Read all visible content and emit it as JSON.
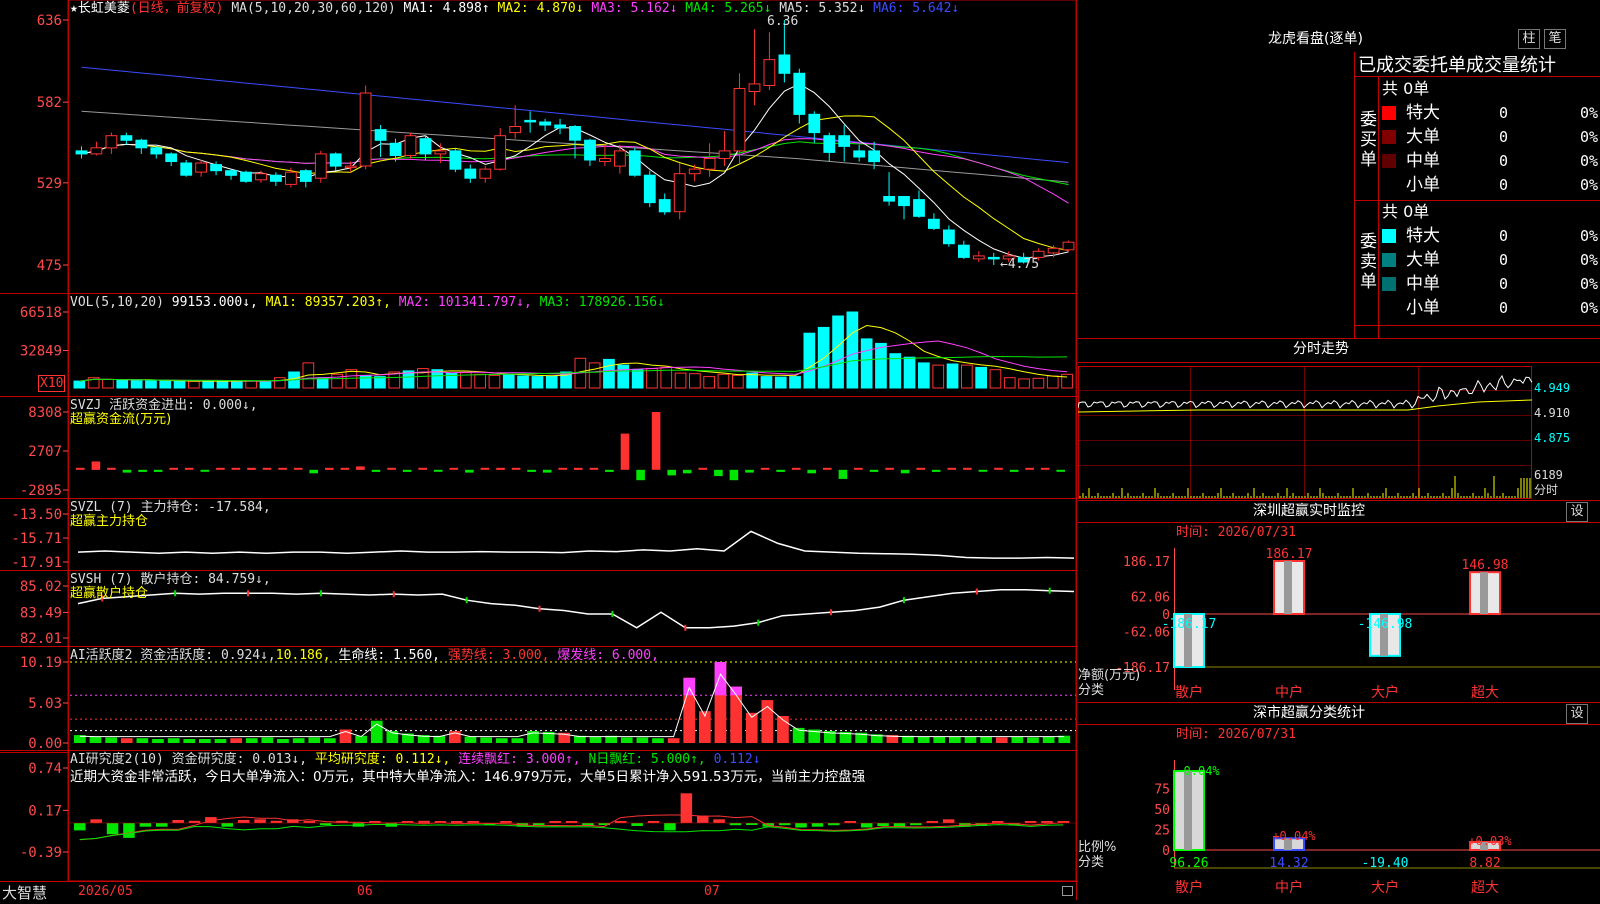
{
  "colors": {
    "up": "#ff3232",
    "down": "#00ffff",
    "grid": "#c00000",
    "axis": "#ff4a4a",
    "white": "#ffffff",
    "yellow": "#ffff00",
    "magenta": "#ff40ff",
    "green": "#00e600",
    "blue": "#3a4cff",
    "gray": "#9a9a9a",
    "olive": "#8c8c00",
    "darkred": "#800000",
    "teal": "#008080"
  },
  "header": {
    "star": "★",
    "name": "长虹美菱",
    "period": "(日线，前复权)",
    "ma_label": "MA(5,10,20,30,60,120)",
    "ma1": "MA1: 4.898↑",
    "ma2": "MA2: 4.870↓",
    "ma3": "MA3: 5.162↓",
    "ma4": "MA4: 5.265↓",
    "ma5": "MA5: 5.352↓",
    "ma6": "MA6: 5.642↓"
  },
  "price_axis": [
    "636",
    "582",
    "529",
    "475"
  ],
  "price_annot": {
    "high": "6.36",
    "low": "←4.75"
  },
  "vol": {
    "title": "VOL(5,10,20)",
    "value": "99153.000↓,",
    "ma1": "MA1: 89357.203↑,",
    "ma2": "MA2: 101341.797↓,",
    "ma3": "MA3: 178926.156↓",
    "axis": [
      "66518",
      "32849"
    ],
    "unit": "X10"
  },
  "svzj": {
    "title": "SVZJ  活跃资金进出: 0.000↓,",
    "subtitle": "超赢资金流(万元)",
    "axis": [
      "8308",
      "2707",
      "-2895"
    ]
  },
  "svzl": {
    "title": "SVZL (7) 主力持仓: -17.584,",
    "subtitle": "超赢主力持仓",
    "axis": [
      "-13.50",
      "-15.71",
      "-17.91"
    ]
  },
  "svsh": {
    "title": "SVSH (7) 散户持仓: 84.759↓,",
    "subtitle": "超赢散户持仓",
    "axis": [
      "85.02",
      "83.49",
      "82.01"
    ]
  },
  "ai1": {
    "t1": "AI活跃度2 资金活跃度: 0.924↓,",
    "t2": "10.186,",
    "t3": "生命线: 1.560,",
    "t4": "强势线: 3.000,",
    "t5": "爆发线: 6.000,",
    "axis": [
      "10.19",
      "5.03",
      "0.00"
    ]
  },
  "ai2": {
    "t1": "AI研究度2(10) 资金研究度: 0.013↓,",
    "t2": "平均研究度: 0.112↓,",
    "t3": "连续飘红: 3.000↑,",
    "t4": "N日飘红: 5.000↑,",
    "t5": "0.112↓",
    "note": "近期大资金非常活跃，今日大单净流入：0万元，其中特大单净流入：146.979万元，大单5日累计净入591.53万元，当前主力控盘强",
    "axis": [
      "0.74",
      "0.17",
      "-0.39"
    ]
  },
  "bottom": {
    "brand": "大智慧",
    "dates": [
      "2026/05",
      "06",
      "07"
    ]
  },
  "longhu": {
    "title": "龙虎看盘(逐单)",
    "btn1": "柱",
    "btn2": "笔",
    "stat_title": "已成交委托单成交量统计",
    "buy_label": "委买单",
    "sell_label": "委卖单",
    "buy_total": "共 0单",
    "sell_total": "共 0单",
    "buy_rows": [
      {
        "label": "特大",
        "count": "0",
        "pct": "0%",
        "color": "#ff0000"
      },
      {
        "label": "大单",
        "count": "0",
        "pct": "0%",
        "color": "#800000"
      },
      {
        "label": "中单",
        "count": "0",
        "pct": "0%",
        "color": "#600000"
      },
      {
        "label": "小单",
        "count": "0",
        "pct": "0%",
        "color": "#000000"
      }
    ],
    "sell_rows": [
      {
        "label": "特大",
        "count": "0",
        "pct": "0%",
        "color": "#00ffff"
      },
      {
        "label": "大单",
        "count": "0",
        "pct": "0%",
        "color": "#008080"
      },
      {
        "label": "中单",
        "count": "0",
        "pct": "0%",
        "color": "#007070"
      },
      {
        "label": "小单",
        "count": "0",
        "pct": "0%",
        "color": "#000000"
      }
    ]
  },
  "intraday": {
    "title": "分时走势",
    "axis": [
      "4.949",
      "4.910",
      "4.875"
    ],
    "vol_top": "6189",
    "vol_label": "分时"
  },
  "monitor": {
    "title": "深圳超赢实时监控",
    "btn": "设",
    "time": "时间: 2026/07/31",
    "axis": [
      "186.17",
      "62.06",
      "0",
      "-62.06",
      "-186.17"
    ],
    "ylabel1": "净额(万元)",
    "ylabel2": "分类",
    "labels": [
      "散户",
      "中户",
      "大户",
      "超大"
    ],
    "bar_labels": [
      "-186.17",
      "186.17",
      "-146.98",
      "146.98"
    ]
  },
  "classify": {
    "title": "深市超赢分类统计",
    "btn": "设",
    "time": "时间: 2026/07/31",
    "axis": [
      "75",
      "50",
      "25",
      "0"
    ],
    "ylabel1": "比例%",
    "ylabel2": "分类",
    "labels": [
      "散户",
      "中户",
      "大户",
      "超大"
    ],
    "top_labels": [
      "-0.04%",
      "+0.04%",
      "+0.03%"
    ],
    "values": [
      "96.26",
      "14.32",
      "-19.40",
      "8.82"
    ]
  },
  "chart_data": [
    {
      "type": "candlestick",
      "title": "长虹美菱 (日线，前复权)",
      "ylim": [
        4.75,
        6.36
      ],
      "ma_labels": [
        "MA1",
        "MA2",
        "MA3",
        "MA4",
        "MA5",
        "MA6"
      ],
      "x": [
        "2026/05",
        "06",
        "07"
      ],
      "candles": [
        [
          5.5,
          5.48,
          5.53,
          5.45
        ],
        [
          5.48,
          5.52,
          5.56,
          5.47
        ],
        [
          5.52,
          5.6,
          5.62,
          5.48
        ],
        [
          5.6,
          5.57,
          5.62,
          5.54
        ],
        [
          5.57,
          5.52,
          5.58,
          5.48
        ],
        [
          5.52,
          5.48,
          5.53,
          5.45
        ],
        [
          5.48,
          5.43,
          5.49,
          5.4
        ],
        [
          5.42,
          5.34,
          5.44,
          5.33
        ],
        [
          5.36,
          5.42,
          5.44,
          5.33
        ],
        [
          5.41,
          5.37,
          5.43,
          5.34
        ],
        [
          5.37,
          5.34,
          5.38,
          5.31
        ],
        [
          5.36,
          5.3,
          5.37,
          5.29
        ],
        [
          5.31,
          5.35,
          5.37,
          5.29
        ],
        [
          5.34,
          5.3,
          5.36,
          5.27
        ],
        [
          5.28,
          5.36,
          5.39,
          5.26
        ],
        [
          5.37,
          5.3,
          5.38,
          5.26
        ],
        [
          5.32,
          5.48,
          5.5,
          5.29
        ],
        [
          5.48,
          5.4,
          5.49,
          5.37
        ],
        [
          5.4,
          5.4,
          5.43,
          5.36
        ],
        [
          5.4,
          5.88,
          5.93,
          5.38
        ],
        [
          5.64,
          5.57,
          5.67,
          5.46
        ],
        [
          5.55,
          5.47,
          5.58,
          5.43
        ],
        [
          5.47,
          5.6,
          5.62,
          5.45
        ],
        [
          5.58,
          5.48,
          5.6,
          5.44
        ],
        [
          5.48,
          5.5,
          5.55,
          5.42
        ],
        [
          5.5,
          5.38,
          5.52,
          5.36
        ],
        [
          5.38,
          5.32,
          5.41,
          5.29
        ],
        [
          5.32,
          5.38,
          5.4,
          5.29
        ],
        [
          5.38,
          5.6,
          5.65,
          5.37
        ],
        [
          5.62,
          5.66,
          5.8,
          5.58
        ],
        [
          5.7,
          5.69,
          5.76,
          5.62
        ],
        [
          5.69,
          5.67,
          5.71,
          5.63
        ],
        [
          5.67,
          5.65,
          5.71,
          5.61
        ],
        [
          5.66,
          5.57,
          5.67,
          5.45
        ],
        [
          5.57,
          5.44,
          5.58,
          5.4
        ],
        [
          5.43,
          5.45,
          5.54,
          5.4
        ],
        [
          5.4,
          5.5,
          5.54,
          5.35
        ],
        [
          5.5,
          5.34,
          5.52,
          5.33
        ],
        [
          5.34,
          5.16,
          5.37,
          5.13
        ],
        [
          5.18,
          5.1,
          5.22,
          5.08
        ],
        [
          5.1,
          5.35,
          5.42,
          5.05
        ],
        [
          5.35,
          5.38,
          5.41,
          5.3
        ],
        [
          5.38,
          5.45,
          5.55,
          5.33
        ],
        [
          5.45,
          5.5,
          5.63,
          5.4
        ],
        [
          5.5,
          5.91,
          6.01,
          5.42
        ],
        [
          5.89,
          5.94,
          6.3,
          5.8
        ],
        [
          5.93,
          6.1,
          6.28,
          5.9
        ],
        [
          6.13,
          6.01,
          6.36,
          5.95
        ],
        [
          6.01,
          5.74,
          6.04,
          5.68
        ],
        [
          5.74,
          5.62,
          5.76,
          5.55
        ],
        [
          5.6,
          5.49,
          5.62,
          5.43
        ],
        [
          5.6,
          5.53,
          5.67,
          5.43
        ],
        [
          5.5,
          5.46,
          5.54,
          5.43
        ],
        [
          5.5,
          5.43,
          5.56,
          5.38
        ],
        [
          5.2,
          5.17,
          5.36,
          5.14
        ],
        [
          5.2,
          5.14,
          5.2,
          5.05
        ],
        [
          5.18,
          5.07,
          5.24,
          5.06
        ],
        [
          5.05,
          4.99,
          5.09,
          4.98
        ],
        [
          4.98,
          4.89,
          5.01,
          4.87
        ],
        [
          4.88,
          4.8,
          4.91,
          4.79
        ],
        [
          4.79,
          4.81,
          4.84,
          4.77
        ],
        [
          4.8,
          4.79,
          4.83,
          4.75
        ],
        [
          4.79,
          4.81,
          4.84,
          4.77
        ],
        [
          4.8,
          4.77,
          4.83,
          4.76
        ],
        [
          4.8,
          4.84,
          4.86,
          4.78
        ],
        [
          4.83,
          4.86,
          4.88,
          4.8
        ],
        [
          4.85,
          4.9,
          4.91,
          4.84
        ]
      ]
    },
    {
      "type": "bar",
      "title": "VOL(5,10,20)",
      "unit": "X10",
      "ylim": [
        0,
        66518
      ],
      "values": [
        6000,
        9000,
        7500,
        6800,
        6500,
        6200,
        6300,
        6000,
        5800,
        6000,
        6200,
        5900,
        6100,
        5600,
        9000,
        14000,
        22000,
        9000,
        12000,
        16000,
        11000,
        10000,
        14000,
        15000,
        17000,
        16000,
        13000,
        13500,
        12000,
        11000,
        11500,
        10500,
        10000,
        10500,
        14000,
        26000,
        22000,
        25000,
        20000,
        16000,
        17000,
        18000,
        13000,
        12500,
        10000,
        12000,
        11000,
        13000,
        10000,
        9500,
        10000,
        48000,
        53000,
        63000,
        66518,
        43000,
        39000,
        30000,
        27000,
        22000,
        20000,
        21000,
        20000,
        18000,
        16000,
        9000,
        8000,
        8500,
        10500,
        12000
      ]
    },
    {
      "type": "bar",
      "title": "SVZJ 超赢资金流(万元)",
      "ylim": [
        -2895,
        8308
      ],
      "values": [
        0,
        1200,
        0,
        -400,
        -300,
        -300,
        0,
        0,
        -200,
        0,
        0,
        300,
        0,
        200,
        0,
        -500,
        300,
        0,
        500,
        -300,
        0,
        -300,
        0,
        -200,
        0,
        -400,
        0,
        300,
        0,
        -300,
        -400,
        0,
        300,
        0,
        -300,
        5200,
        -1500,
        8308,
        -800,
        -500,
        0,
        -900,
        -1500,
        -400,
        0,
        -300,
        0,
        -500,
        0,
        -1300,
        0,
        -300,
        0,
        -500,
        0,
        -300,
        0,
        0,
        -200,
        0,
        -300,
        0,
        0,
        -200
      ]
    },
    {
      "type": "line",
      "title": "SVZL 主力持仓",
      "ylim": [
        -17.91,
        -13.5
      ],
      "values": [
        -17.0,
        -16.9,
        -17.0,
        -17.1,
        -17.0,
        -17.1,
        -17.0,
        -17.1,
        -17.0,
        -17.0,
        -17.1,
        -17.0,
        -16.9,
        -17.0,
        -17.0,
        -16.95,
        -17.0,
        -17.0,
        -17.05,
        -16.9,
        -16.95,
        -16.8,
        -16.9,
        -16.7,
        -16.9,
        -15.1,
        -16.2,
        -16.9,
        -17.0,
        -17.1,
        -17.15,
        -17.2,
        -17.3,
        -17.5,
        -17.55,
        -17.55,
        -17.5,
        -17.55
      ]
    },
    {
      "type": "line",
      "title": "SVSH 散户持仓",
      "ylim": [
        82.01,
        85.02
      ],
      "values": [
        84.0,
        84.3,
        84.4,
        84.5,
        84.6,
        84.55,
        84.6,
        84.6,
        84.6,
        84.55,
        84.6,
        84.55,
        84.5,
        84.55,
        84.5,
        84.55,
        84.2,
        84.0,
        83.9,
        83.7,
        83.6,
        83.4,
        83.4,
        82.6,
        83.5,
        82.6,
        82.6,
        82.7,
        82.9,
        83.3,
        83.4,
        83.5,
        83.6,
        83.8,
        84.2,
        84.4,
        84.6,
        84.7,
        84.8,
        84.8,
        84.75,
        84.7
      ]
    },
    {
      "type": "bar",
      "title": "AI活跃度2 资金活跃度",
      "ylim": [
        0,
        10.19
      ],
      "values": [
        1.0,
        0.8,
        0.7,
        0.6,
        0.6,
        0.5,
        0.6,
        0.5,
        0.5,
        0.5,
        0.6,
        0.6,
        0.7,
        0.5,
        0.6,
        0.7,
        0.6,
        1.7,
        0.9,
        2.8,
        1.5,
        1.2,
        1.0,
        0.9,
        1.5,
        0.8,
        0.7,
        0.6,
        0.6,
        1.5,
        1.4,
        1.3,
        0.9,
        0.8,
        0.9,
        0.7,
        0.7,
        0.6,
        0.6,
        8.2,
        4.0,
        10.186,
        7.1,
        3.8,
        5.4,
        3.4,
        1.9,
        1.7,
        1.5,
        1.4,
        1.3,
        1.1,
        1.0,
        0.9,
        0.8,
        0.8,
        0.8,
        0.8,
        0.8,
        0.7,
        0.8,
        0.7,
        0.8,
        0.924
      ]
    },
    {
      "type": "bar",
      "title": "AI研究度2(10) 资金研究度",
      "ylim": [
        -0.39,
        0.74
      ],
      "values": [
        -0.1,
        0.05,
        -0.15,
        -0.2,
        -0.05,
        -0.05,
        0.04,
        0.03,
        0.08,
        -0.05,
        0.04,
        0.05,
        0.03,
        0.05,
        0.02,
        -0.02,
        0.03,
        -0.05,
        0.01,
        -0.05,
        0.02,
        0.03,
        0.01,
        0.02,
        0.0,
        -0.03,
        0.01,
        -0.05,
        -0.03,
        0.02,
        0.01,
        -0.04,
        -0.02,
        0.01,
        -0.04,
        0.02,
        -0.1,
        0.4,
        0.1,
        0.05,
        -0.03,
        -0.02,
        -0.05,
        -0.03,
        -0.06,
        -0.05,
        -0.03,
        0.01,
        -0.06,
        -0.04,
        -0.05,
        -0.03,
        0.02,
        0.05,
        -0.05,
        -0.04,
        0.02,
        -0.03,
        0.01,
        0.0,
        0.012
      ]
    },
    {
      "type": "bar",
      "title": "深圳超赢实时监控",
      "categories": [
        "散户",
        "中户",
        "大户",
        "超大"
      ],
      "values": [
        -186.17,
        186.17,
        -146.98,
        146.98
      ],
      "ylim": [
        -186.17,
        186.17
      ]
    },
    {
      "type": "bar",
      "title": "深市超赢分类统计",
      "categories": [
        "散户",
        "中户",
        "大户",
        "超大"
      ],
      "values": [
        96.26,
        14.32,
        -19.4,
        8.82
      ],
      "ylim": [
        0,
        100
      ]
    }
  ]
}
